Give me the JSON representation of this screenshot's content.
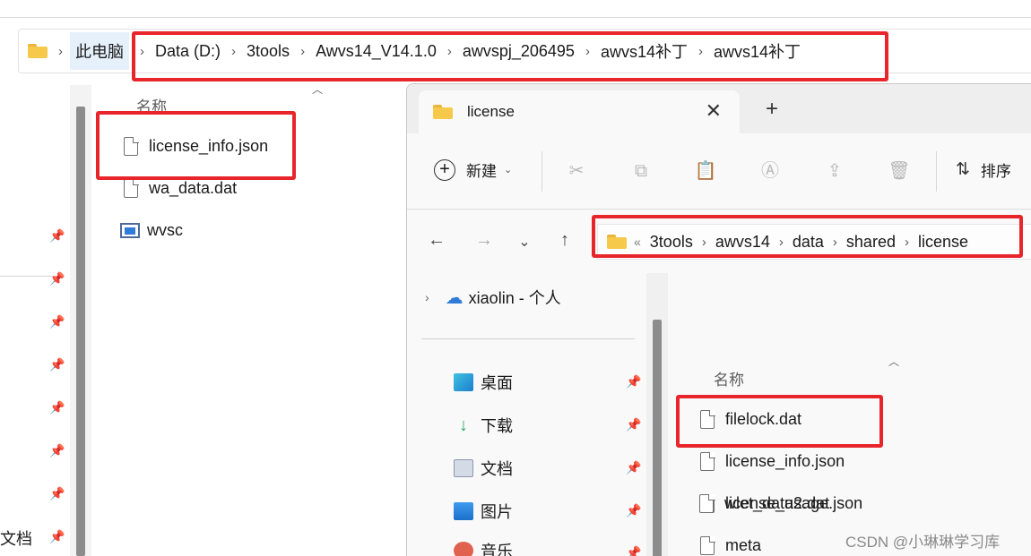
{
  "back_window": {
    "breadcrumb": [
      "此电脑",
      "Data (D:)",
      "3tools",
      "Awvs14_V14.1.0",
      "awvspj_206495",
      "awvs14补丁",
      "awvs14补丁"
    ],
    "column_header": "名称",
    "files": [
      {
        "name": "license_info.json",
        "icon": "file-icon"
      },
      {
        "name": "wa_data.dat",
        "icon": "file-icon"
      },
      {
        "name": "wvsc",
        "icon": "executable-icon"
      }
    ],
    "nav_partial_label": "文档"
  },
  "front_window": {
    "tab_title": "license",
    "toolbar": {
      "new_label": "新建",
      "sort_label": "排序",
      "icons": [
        "cut-icon",
        "copy-icon",
        "paste-icon",
        "rename-icon",
        "share-icon",
        "delete-icon"
      ]
    },
    "address": [
      "3tools",
      "awvs14",
      "data",
      "shared",
      "license"
    ],
    "nav_tree": {
      "cloud": "xiaolin - 个人",
      "items": [
        "桌面",
        "下载",
        "文档",
        "图片",
        "音乐"
      ]
    },
    "column_header": "名称",
    "files": [
      {
        "name": "filelock.dat"
      },
      {
        "name": "license_info.json"
      },
      {
        "name": "license_usage.json"
      },
      {
        "name": "meta"
      },
      {
        "name": "wlet_data2.dat"
      }
    ]
  },
  "colors": {
    "highlight": "#e8252a",
    "folder": "#f6c94b",
    "accent": "#2f7bd8"
  },
  "watermark": "CSDN @小琳琳学习库"
}
